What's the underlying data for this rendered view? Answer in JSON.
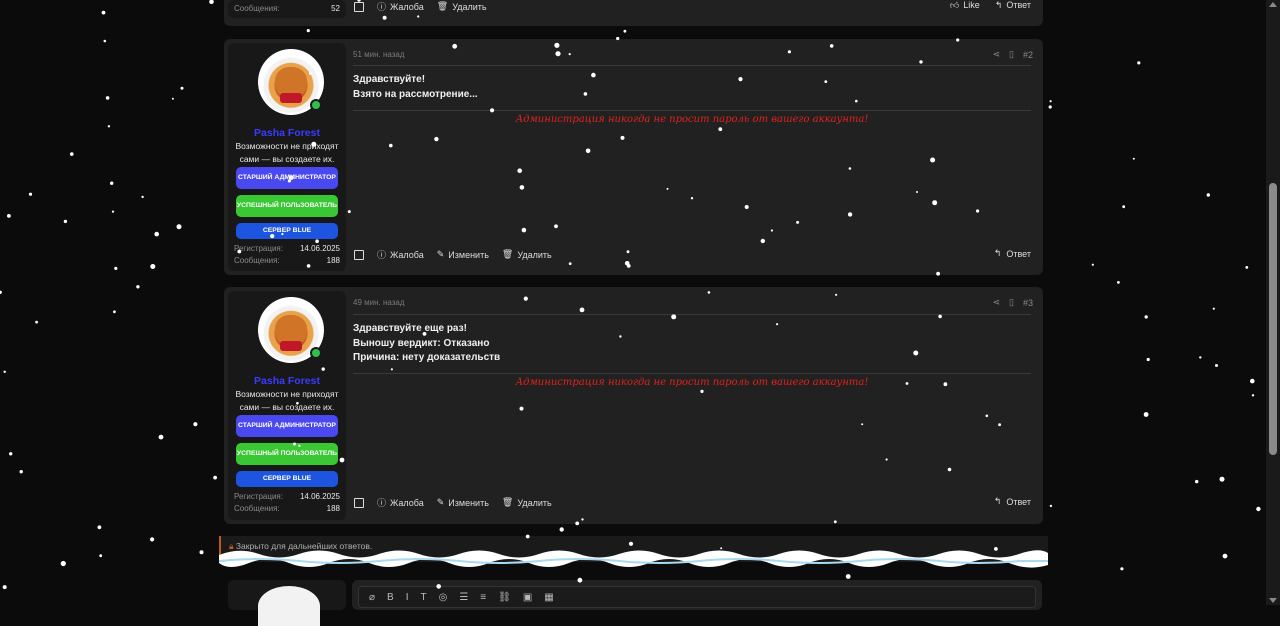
{
  "top_post": {
    "stat_label": "Сообщения:",
    "stat_value": "52",
    "actions": [
      "Жалоба",
      "Удалить"
    ],
    "like": "Like",
    "reply": "Ответ"
  },
  "posts": [
    {
      "time": "51 мин. назад",
      "number": "#2",
      "lines": [
        "Здравствуйте!",
        "Взято на рассмотрение..."
      ],
      "actions": [
        "Жалоба",
        "Изменить",
        "Удалить"
      ],
      "reply": "Ответ"
    },
    {
      "time": "49 мин. назад",
      "number": "#3",
      "lines": [
        "Здравствуйте еще раз!",
        "Выношу вердикт: Отказано",
        "Причина: нету доказательств"
      ],
      "actions": [
        "Жалоба",
        "Изменить",
        "Удалить"
      ],
      "reply": "Ответ"
    }
  ],
  "user": {
    "name": "Pasha Forest",
    "title": "Возможности не приходят сами — вы создаете их.",
    "badges": [
      "СТАРШИЙ АДМИНИСТРАТОР",
      "УСПЕШНЫЙ ПОЛЬЗОВАТЕЛЬ",
      "СЕРВЕР BLUE"
    ],
    "reg_label": "Регистрация:",
    "reg_value": "14.06.2025",
    "msg_label": "Сообщения:",
    "msg_value": "188"
  },
  "signature": "Администрация никогда не просит пароль от вашего аккаунта!",
  "closed_notice": "Закрыто для дальнейших ответов.",
  "colors": {
    "username": "#3b3bff",
    "badge_admin": "#4a49ef",
    "badge_user": "#39c833",
    "badge_server": "#1e55e0",
    "signature": "#e0221e",
    "online": "#2fbf4a"
  }
}
